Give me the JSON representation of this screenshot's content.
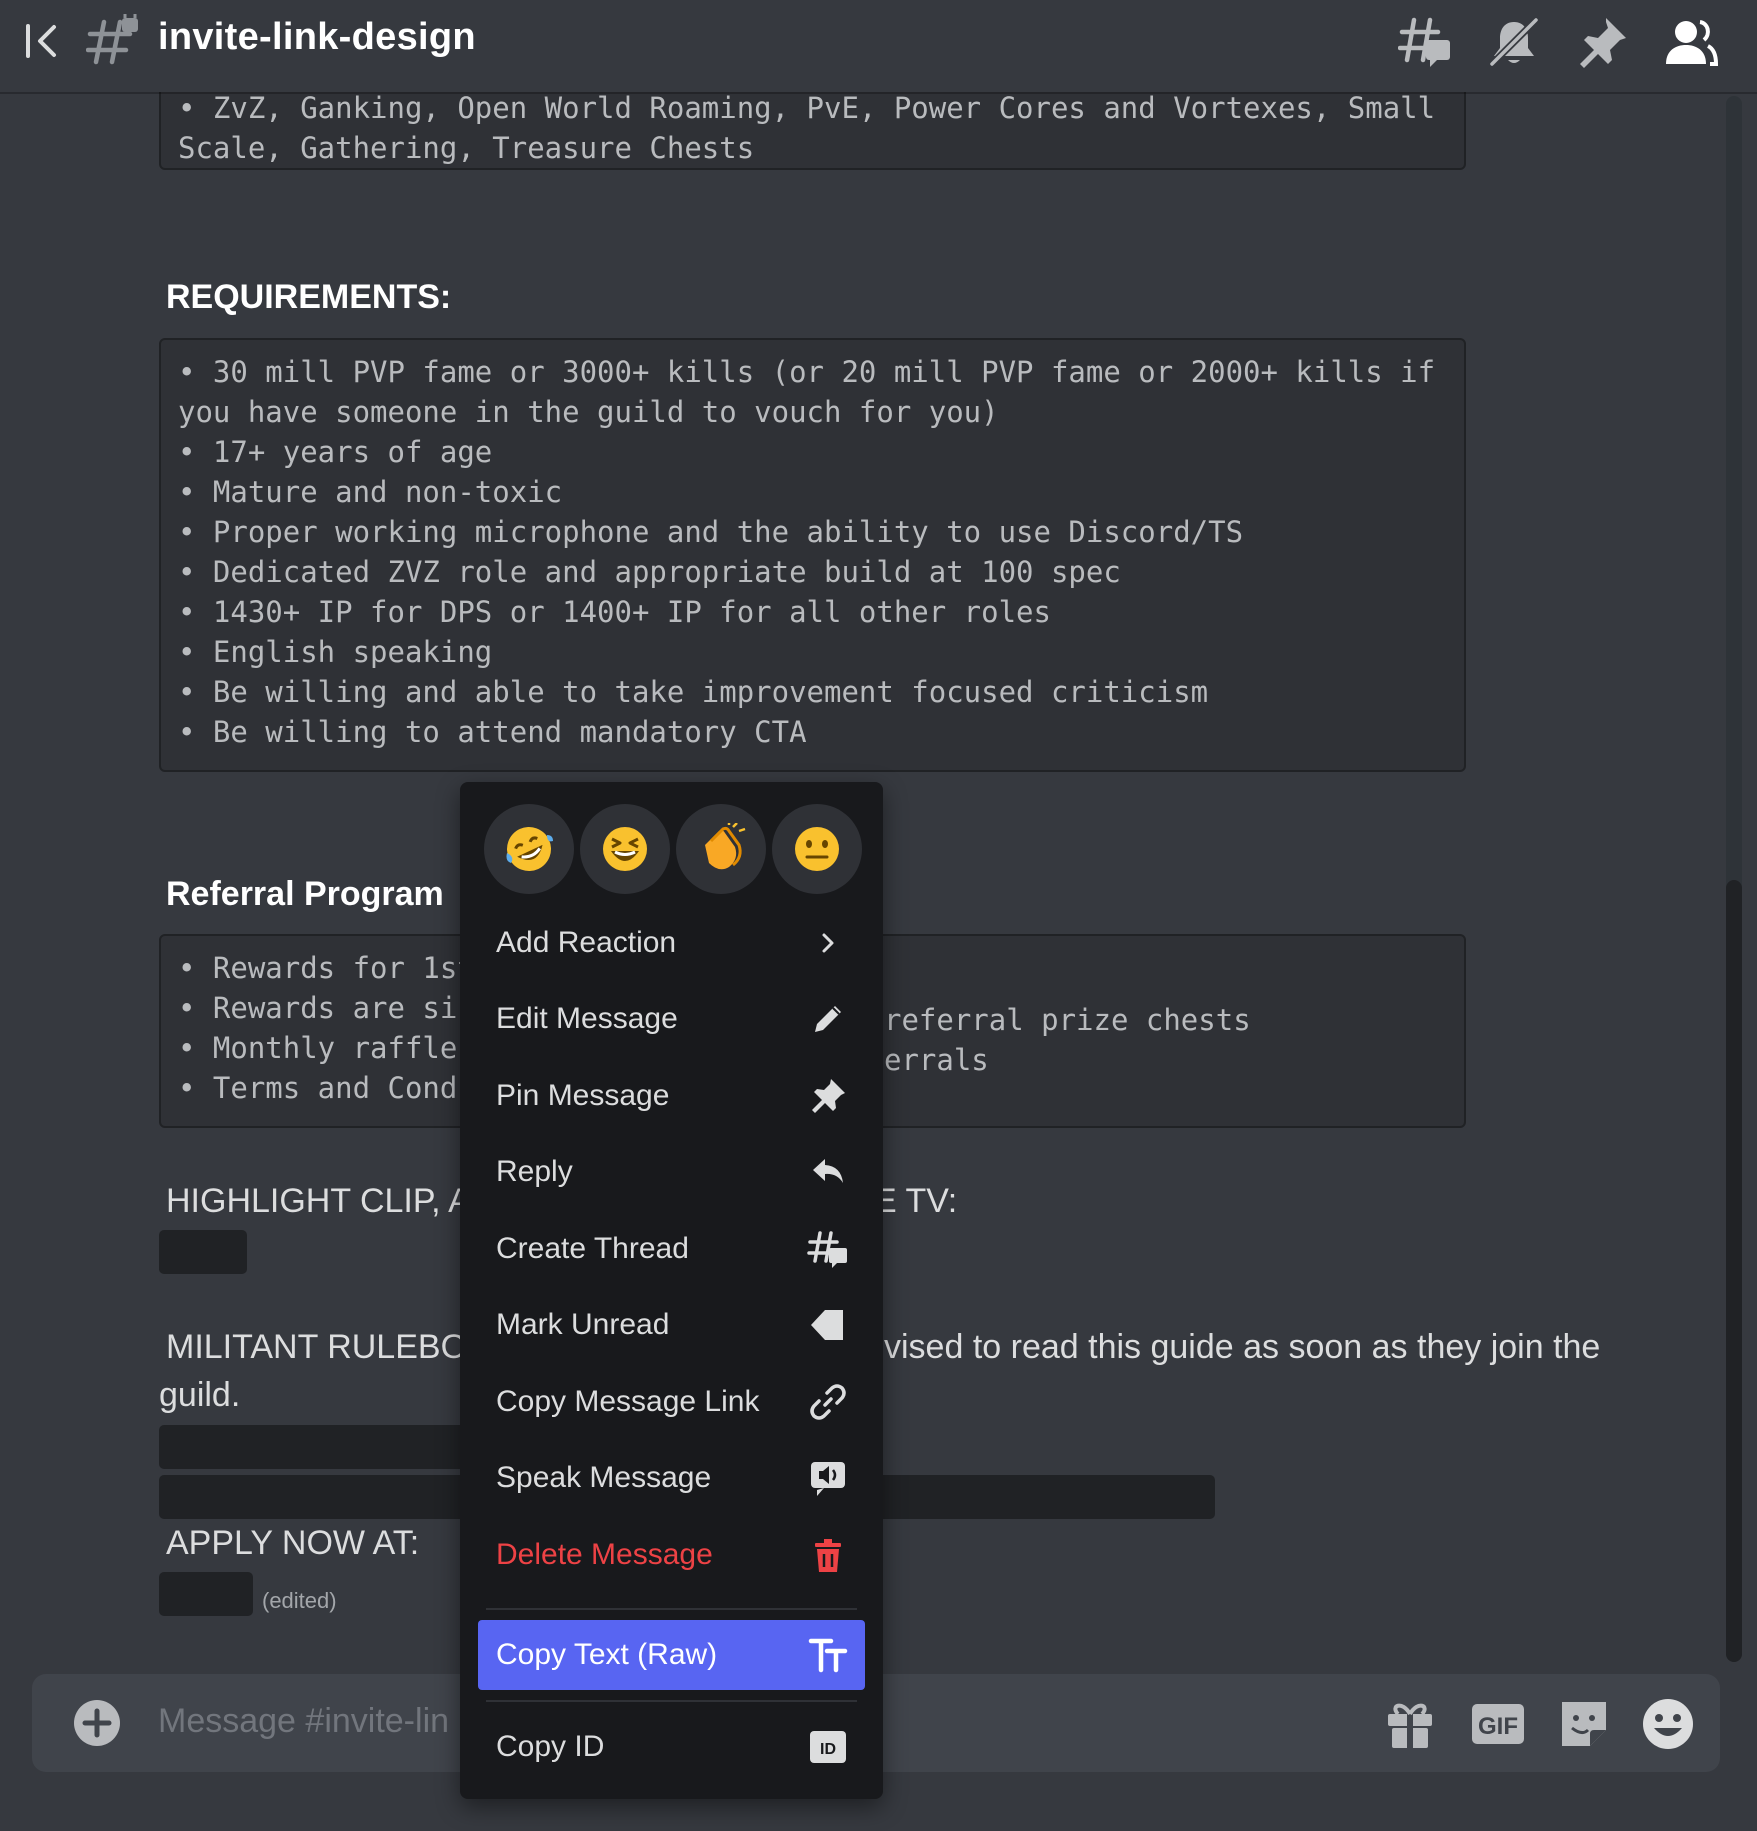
{
  "header": {
    "channel_name": "invite-link-design"
  },
  "messages": {
    "activities_block": [
      "• ZvZ, Ganking, Open World Roaming, PvE, Power Cores and Vortexes, Small",
      "Scale, Gathering, Treasure Chests"
    ],
    "requirements_title": "REQUIREMENTS:",
    "requirements_block": [
      "• 30 mill PVP fame or 3000+ kills (or 20 mill PVP fame or 2000+ kills if",
      "you have someone in the guild to vouch for you)",
      "• 17+ years of age",
      "• Mature and non-toxic",
      "• Proper working microphone and the ability to use Discord/TS",
      "• Dedicated ZVZ role and appropriate build at 100 spec",
      "• 1430+ IP for DPS or 1400+ IP for all other roles",
      "• English speaking",
      "• Be willing and able to take improvement focused criticism",
      "• Be willing to attend mandatory CTA"
    ],
    "referral_title": "Referral Program",
    "referral_left": [
      "• Rewards for 1st",
      "• Rewards are si",
      "• Monthly raffle",
      "• Terms and Cond"
    ],
    "referral_right": [
      "referral prize chests",
      "errals"
    ],
    "highlight_left": "HIGHLIGHT CLIP, A",
    "highlight_right": "E TV:",
    "militant_left": "MILITANT RULEBO",
    "militant_right": "vised to read this guide as soon as they join the",
    "militant_line2": "guild.",
    "apply_label": "APPLY NOW AT:",
    "edited_label": "(edited)"
  },
  "composer": {
    "placeholder": "Message #invite-lin"
  },
  "context_menu": {
    "quick_reactions": [
      "🤣",
      "😆",
      "👏",
      "😐"
    ],
    "items": [
      {
        "label": "Add Reaction",
        "icon": "chevron-right-icon"
      },
      {
        "label": "Edit Message",
        "icon": "pencil-icon"
      },
      {
        "label": "Pin Message",
        "icon": "pin-icon"
      },
      {
        "label": "Reply",
        "icon": "reply-icon"
      },
      {
        "label": "Create Thread",
        "icon": "thread-icon"
      },
      {
        "label": "Mark Unread",
        "icon": "mark-unread-icon"
      },
      {
        "label": "Copy Message Link",
        "icon": "link-icon"
      },
      {
        "label": "Speak Message",
        "icon": "speak-icon"
      },
      {
        "label": "Delete Message",
        "icon": "trash-icon"
      },
      {
        "label": "Copy Text (Raw)",
        "icon": "text-icon"
      },
      {
        "label": "Copy ID",
        "icon": "id-icon"
      }
    ]
  },
  "colors": {
    "background": "#36393f",
    "codeblock_bg": "#2f3136",
    "menu_bg": "#18191c",
    "accent": "#5865f2",
    "danger": "#ed4245"
  }
}
